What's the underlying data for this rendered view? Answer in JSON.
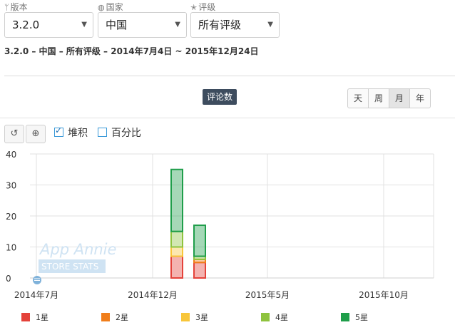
{
  "filters": {
    "version": {
      "label": "版本",
      "value": "3.2.0"
    },
    "country": {
      "label": "国家",
      "value": "中国"
    },
    "rating": {
      "label": "评级",
      "value": "所有评级"
    }
  },
  "range_title": "3.2.0 – 中国 – 所有评级 – 2014年7月4日 ~ 2015年12月24日",
  "metric_chip": "评论数",
  "period_buttons": [
    "天",
    "周",
    "月",
    "年"
  ],
  "active_period": "月",
  "options": {
    "stacked": "堆积",
    "percent": "百分比",
    "stacked_checked": true,
    "percent_checked": false
  },
  "watermark": {
    "line1": "App Annie",
    "line2": "STORE STATS"
  },
  "colors": {
    "1星": "#e4423a",
    "2星": "#f07e1b",
    "3星": "#f8c63a",
    "4星": "#8fc33e",
    "5星": "#1f9e4a"
  },
  "chart_data": {
    "type": "bar",
    "stacked": true,
    "ylim": [
      0,
      40
    ],
    "yticks": [
      0,
      10,
      20,
      30,
      40
    ],
    "xticks": [
      "2014年7月",
      "2014年12月",
      "2015年5月",
      "2015年10月"
    ],
    "categories": [
      "2014年12月",
      "2015年1月"
    ],
    "series": [
      {
        "name": "1星",
        "values": [
          7,
          5
        ]
      },
      {
        "name": "2星",
        "values": [
          0,
          1
        ]
      },
      {
        "name": "3星",
        "values": [
          3,
          0
        ]
      },
      {
        "name": "4星",
        "values": [
          5,
          1
        ]
      },
      {
        "name": "5星",
        "values": [
          20,
          10
        ]
      }
    ]
  }
}
